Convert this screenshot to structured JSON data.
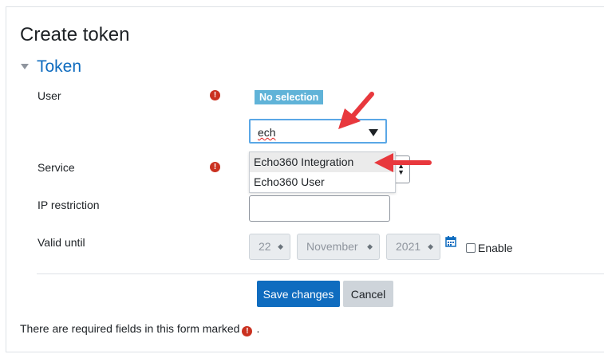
{
  "page": {
    "title": "Create token"
  },
  "section": {
    "title": "Token"
  },
  "fields": {
    "user": {
      "label": "User",
      "selection_badge": "No selection",
      "search_value": "ech"
    },
    "service": {
      "label": "Service",
      "options": [
        "Echo360 Integration",
        "Echo360 User"
      ]
    },
    "ip_restriction": {
      "label": "IP restriction",
      "value": ""
    },
    "valid_until": {
      "label": "Valid until",
      "day": "22",
      "month": "November",
      "year": "2021",
      "enable_label": "Enable",
      "enabled": false
    }
  },
  "buttons": {
    "save": "Save changes",
    "cancel": "Cancel"
  },
  "footer": {
    "prefix": "There are required fields in this form marked",
    "suffix": "."
  },
  "icons": {
    "required": "exclamation-circle-icon",
    "section_toggle": "caret-down-icon",
    "calendar": "calendar-icon",
    "annotation": "red-arrow-icon"
  },
  "colors": {
    "accent": "#0f6cbf",
    "required": "#ca3120",
    "badge": "#60b3d8",
    "annotation": "#e8383d"
  }
}
